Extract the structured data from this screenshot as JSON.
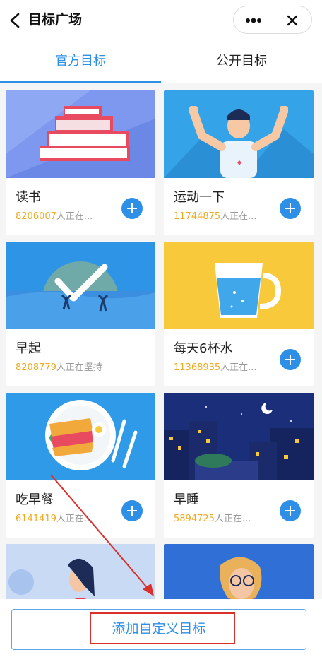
{
  "header": {
    "title": "目标广场",
    "back_icon": "chevron-left-icon",
    "more_icon": "more-dots-icon",
    "close_icon": "close-icon"
  },
  "tabs": [
    {
      "label": "官方目标",
      "active": true
    },
    {
      "label": "公开目标",
      "active": false
    }
  ],
  "goals": [
    {
      "name": "读书",
      "count": "8206007",
      "suffix": "人正在...",
      "art": "books"
    },
    {
      "name": "运动一下",
      "count": "11744875",
      "suffix": "人正在...",
      "art": "fitness"
    },
    {
      "name": "早起",
      "count": "8208779",
      "suffix": "人正在坚持",
      "art": "sunrise"
    },
    {
      "name": "每天6杯水",
      "count": "11368935",
      "suffix": "人正在...",
      "art": "water-cup"
    },
    {
      "name": "吃早餐",
      "count": "6141419",
      "suffix": "人正在...",
      "art": "breakfast"
    },
    {
      "name": "早睡",
      "count": "5894725",
      "suffix": "人正在...",
      "art": "night-city"
    },
    {
      "name": "",
      "count": "",
      "suffix": "",
      "art": "woman"
    },
    {
      "name": "",
      "count": "",
      "suffix": "",
      "art": "glasses-woman"
    }
  ],
  "footer": {
    "add_custom_label": "添加自定义目标"
  },
  "colors": {
    "accent": "#2e8fe6",
    "count": "#f0a91c",
    "annotation": "#d9302c"
  }
}
